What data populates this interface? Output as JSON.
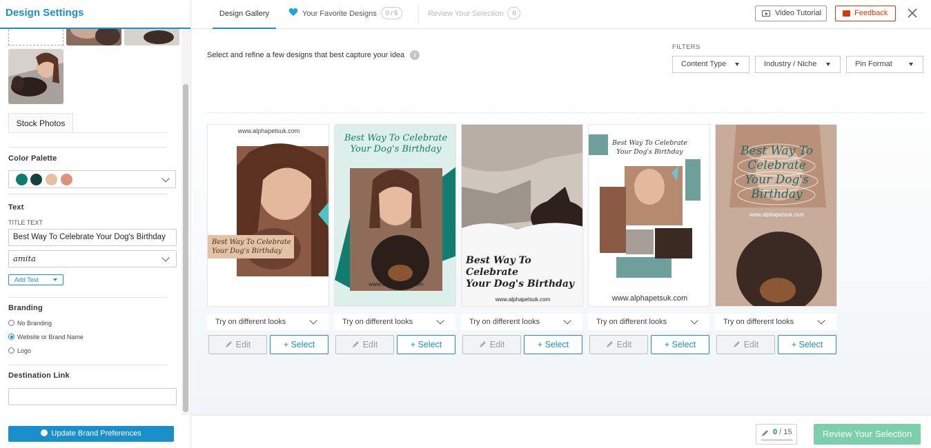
{
  "sidebar": {
    "title": "Design Settings",
    "stock_tab": "Stock Photos",
    "palette": {
      "label": "Color Palette",
      "colors": [
        "#0f7b6c",
        "#14403d",
        "#e5c0a1",
        "#d8957a"
      ]
    },
    "text": {
      "label": "Text",
      "title_text_label": "TITLE TEXT",
      "title_value": "Best Way To Celebrate Your Dog's Birthday",
      "font_value": "amita",
      "add_text": "Add Text"
    },
    "branding": {
      "label": "Branding",
      "options": [
        "No Branding",
        "Website or Brand Name",
        "Logo"
      ],
      "selected": "Website or Brand Name"
    },
    "destination": {
      "label": "Destination Link",
      "value": ""
    },
    "update_button": "Update Brand Preferences"
  },
  "topbar": {
    "tabs": {
      "gallery": "Design Gallery",
      "favorites": "Your Favorite Designs",
      "favorites_count": "0 / 5",
      "review": "Review Your Selection",
      "review_count": "0"
    },
    "video_tutorial": "Video Tutorial",
    "feedback": "Feedback"
  },
  "main": {
    "intro": "Select and refine a few designs that best capture your idea",
    "info_icon": "i",
    "filters_label": "FILTERS",
    "filters": [
      "Content Type",
      "Industry / Niche",
      "Pin Format"
    ]
  },
  "cards": {
    "headline_line1": "Best Way To Celebrate",
    "headline_line2": "Your Dog's Birthday",
    "stack_line1": "Best Way To",
    "stack_line2": "Celebrate",
    "stack_line3": "Your Dog's",
    "stack_line4": "Birthday",
    "website": "www.alphapetsuk.com",
    "look_label": "Try on different looks",
    "edit_label": "Edit",
    "select_label": "+ Select"
  },
  "bottombar": {
    "progress_current": "0",
    "progress_total": " / 15",
    "review_button": "Review Your Selection"
  }
}
